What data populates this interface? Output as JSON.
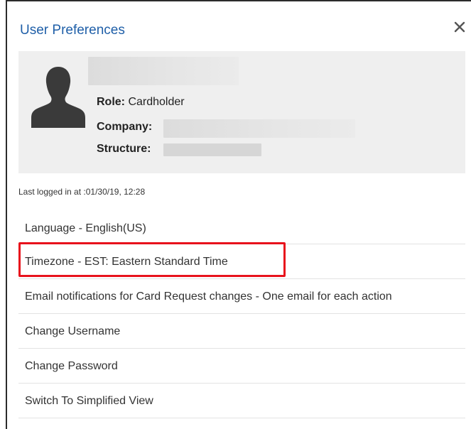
{
  "dialog": {
    "title": "User Preferences",
    "close_icon": "close-icon"
  },
  "profile": {
    "avatar_icon": "user-silhouette-icon",
    "role_label": "Role:",
    "role_value": "Cardholder",
    "company_label": "Company:",
    "structure_label": "Structure:"
  },
  "last_login": "Last logged in at :01/30/19, 12:28",
  "menu": {
    "items": [
      {
        "label": "Language - English(US)"
      },
      {
        "label": "Timezone - EST: Eastern Standard Time"
      },
      {
        "label": "Email notifications for Card Request changes - One email for each action"
      },
      {
        "label": "Change Username"
      },
      {
        "label": "Change Password"
      },
      {
        "label": "Switch To Simplified View"
      }
    ]
  },
  "colors": {
    "title": "#1f5fa8",
    "highlight_border": "#e8121c",
    "profile_bg": "#efefef"
  }
}
